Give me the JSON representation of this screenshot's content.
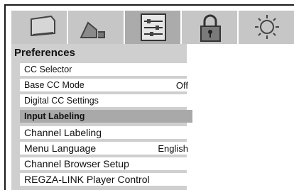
{
  "tabs": [
    {
      "icon": "picture-icon",
      "active": false
    },
    {
      "icon": "sound-icon",
      "active": false
    },
    {
      "icon": "setup-sliders-icon",
      "active": true
    },
    {
      "icon": "lock-icon",
      "active": false
    },
    {
      "icon": "settings-sun-icon",
      "active": false
    }
  ],
  "menu": {
    "title": "Preferences",
    "items": [
      {
        "label": "CC Selector",
        "value": ""
      },
      {
        "label": "Base CC Mode",
        "value": "Off"
      },
      {
        "label": "Digital CC Settings",
        "value": ""
      },
      {
        "label": "Input Labeling",
        "value": "",
        "selected": true
      },
      {
        "label": "Channel Labeling",
        "value": ""
      },
      {
        "label": "Menu Language",
        "value": "English"
      },
      {
        "label": "Channel Browser Setup",
        "value": ""
      },
      {
        "label": "REGZA-LINK Player Control",
        "value": ""
      }
    ]
  },
  "colors": {
    "tab_bar": "#c6c6c6",
    "tab_active": "#ababab",
    "panel": "#cfcfcf",
    "selected_row": "#a9a9a9"
  }
}
